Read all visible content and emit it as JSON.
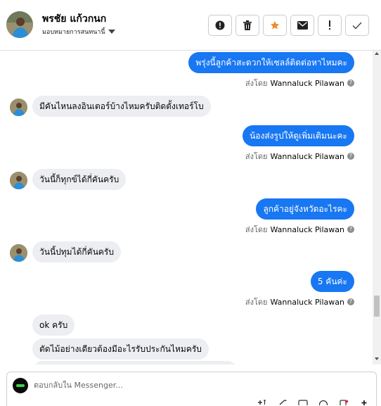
{
  "header": {
    "contact_name": "พรชัย แก้วกนก",
    "assign_label": "มอบหมายการสนทนานี้"
  },
  "thread": {
    "sent_by_prefix": "ส่งโดย",
    "agent_name": "Wannaluck Pilawan",
    "help_glyph": "?",
    "messages": [
      {
        "dir": "out",
        "text": "พรุ่งนี้ลูกค้าสะดวกให้เซลล์ติดต่อหาไหมคะ"
      },
      {
        "dir": "in",
        "text": "มีคันไหนลงอินเตอร์บ้างไหมครับติดตั้งเทอร์โบ"
      },
      {
        "dir": "out",
        "text": "น้องส่งรูปให้ดูเพิ่มเติมนะคะ"
      },
      {
        "dir": "in",
        "text": "วันนี้ก็ทุกข์ได้กี่คันครับ"
      },
      {
        "dir": "out",
        "text": "ลูกค้าอยู่จังหวัดอะไรคะ"
      },
      {
        "dir": "in",
        "text": "วันนี้ปทุมได้กี่คันครับ"
      },
      {
        "dir": "out",
        "text": "5 คันค่ะ"
      },
      {
        "dir": "in",
        "text": "ok ครับ"
      },
      {
        "dir": "in",
        "text": "ตัดไม้อย่างเดียวต้องมีอะไรรับประกันไหมครับ"
      }
    ]
  },
  "composer": {
    "placeholder": "ตอบกลับใน Messenger..."
  },
  "icons": {
    "alert": "alert-circle-icon",
    "trash": "trash-icon",
    "star": "star-icon",
    "mail": "envelope-icon",
    "important": "exclamation-icon",
    "done": "checkmark-icon"
  },
  "colors": {
    "accent": "#1877f2",
    "incoming_bubble": "#eceef1",
    "star": "#f28b24"
  }
}
